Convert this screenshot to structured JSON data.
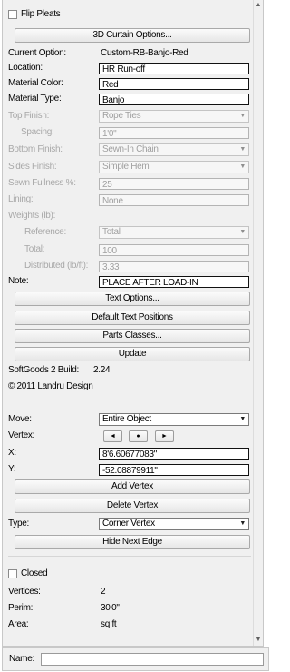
{
  "top_checkbox_label": "Flip Pleats",
  "buttons": {
    "curtain_options": "3D Curtain Options...",
    "text_options": "Text Options...",
    "default_text_positions": "Default Text Positions",
    "parts_classes": "Parts Classes...",
    "update": "Update",
    "add_vertex": "Add Vertex",
    "delete_vertex": "Delete Vertex",
    "hide_next_edge": "Hide Next Edge"
  },
  "current_option": {
    "label": "Current Option:",
    "value": "Custom-RB-Banjo-Red"
  },
  "location": {
    "label": "Location:",
    "value": "HR Run-off"
  },
  "material_color": {
    "label": "Material Color:",
    "value": "Red"
  },
  "material_type": {
    "label": "Material Type:",
    "value": "Banjo"
  },
  "top_finish": {
    "label": "Top Finish:",
    "value": "Rope Ties"
  },
  "spacing": {
    "label": "Spacing:",
    "value": "1'0\""
  },
  "bottom_finish": {
    "label": "Bottom Finish:",
    "value": "Sewn-In Chain"
  },
  "sides_finish": {
    "label": "Sides Finish:",
    "value": "Simple Hem"
  },
  "sewn_fullness": {
    "label": "Sewn Fullness %:",
    "value": "25"
  },
  "lining": {
    "label": "Lining:",
    "value": "None"
  },
  "weights": {
    "label": "Weights (lb):"
  },
  "reference": {
    "label": "Reference:",
    "value": "Total"
  },
  "total": {
    "label": "Total:",
    "value": "100"
  },
  "distributed": {
    "label": "Distributed (lb/ft):",
    "value": "3.33"
  },
  "note": {
    "label": "Note:",
    "value": "PLACE AFTER LOAD-IN"
  },
  "build_info": {
    "label": "SoftGoods 2 Build:",
    "value": "2.24"
  },
  "copyright": "© 2011 Landru Design",
  "move": {
    "label": "Move:",
    "value": "Entire Object"
  },
  "vertex": {
    "label": "Vertex:"
  },
  "x": {
    "label": "X:",
    "value": "8'6.60677083\""
  },
  "y": {
    "label": "Y:",
    "value": "-52.08879911\""
  },
  "type": {
    "label": "Type:",
    "value": "Corner Vertex"
  },
  "closed_label": "Closed",
  "vertices": {
    "label": "Vertices:",
    "value": "2"
  },
  "perim": {
    "label": "Perim:",
    "value": "30'0\""
  },
  "area": {
    "label": "Area:",
    "value": "sq ft"
  },
  "name_field": {
    "label": "Name:",
    "value": ""
  },
  "icons": [
    "dropdown-arrow-icon",
    "left-arrow-icon",
    "dot-icon",
    "right-arrow-icon",
    "scroll-up-icon",
    "scroll-down-icon"
  ]
}
